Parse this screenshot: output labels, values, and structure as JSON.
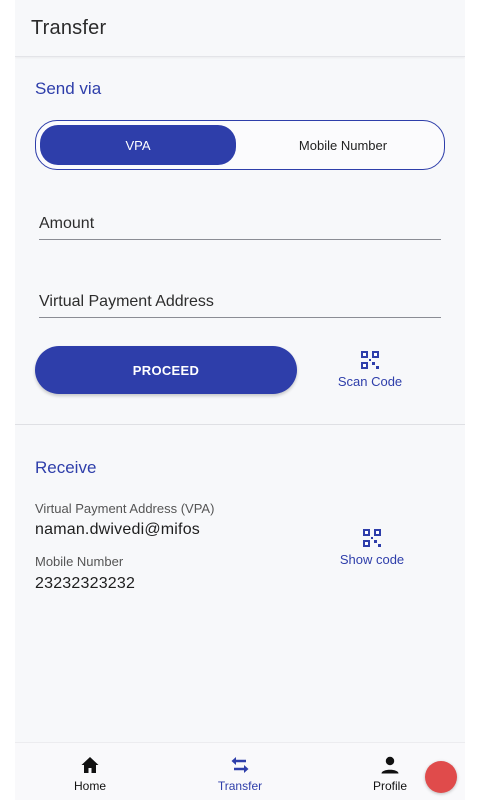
{
  "app_bar": {
    "title": "Transfer"
  },
  "send": {
    "section_title": "Send via",
    "toggle": {
      "options": [
        "VPA",
        "Mobile Number"
      ],
      "selected": "VPA"
    },
    "amount_label": "Amount",
    "vpa_label": "Virtual Payment Address",
    "proceed_label": "PROCEED",
    "scan_label": "Scan Code"
  },
  "receive": {
    "section_title": "Receive",
    "vpa_label": "Virtual Payment Address (VPA)",
    "vpa_value": "naman.dwivedi@mifos",
    "mobile_label": "Mobile Number",
    "mobile_value": "23232323232",
    "show_code_label": "Show code"
  },
  "bottom_nav": {
    "items": [
      {
        "label": "Home",
        "icon": "home-icon"
      },
      {
        "label": "Transfer",
        "icon": "swap-icon"
      },
      {
        "label": "Profile",
        "icon": "person-icon"
      }
    ],
    "active": "Transfer"
  },
  "colors": {
    "accent": "#2e3eaa",
    "background": "#f7f8fa",
    "fab": "#e04b4b"
  }
}
